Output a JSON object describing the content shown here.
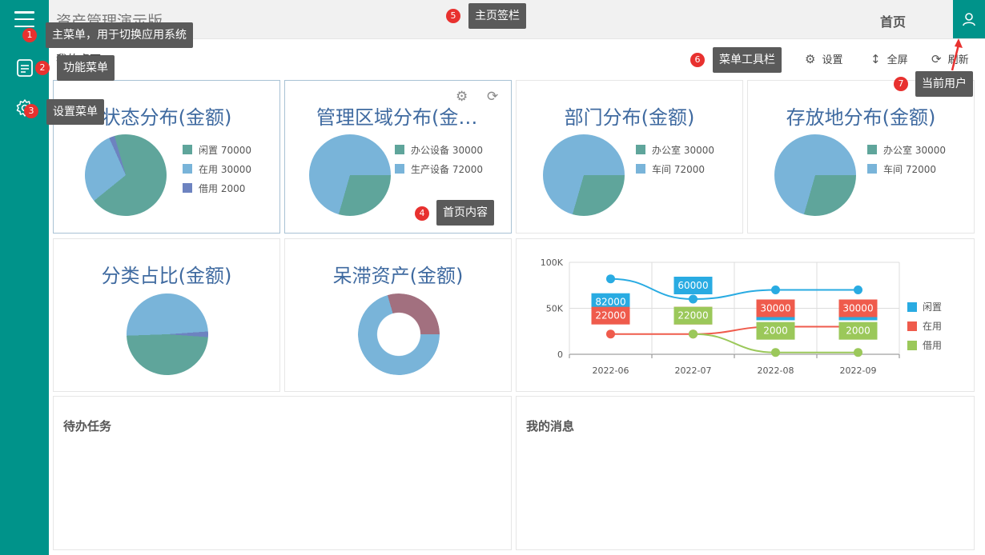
{
  "header": {
    "app_title": "资产管理演示版",
    "home_tab": "首页"
  },
  "desk": {
    "label": "我的桌面"
  },
  "toolbar": {
    "settings": "设置",
    "fullscreen": "全屏",
    "refresh": "刷新"
  },
  "icons": {
    "menu": "hamburger-icon",
    "func": "document-icon",
    "settings": "gear-icon",
    "user": "user-icon"
  },
  "colors": {
    "sidebar": "#00938a",
    "teal": "#5fa59b",
    "blue": "#79b4d9",
    "purple": "#6d83c0",
    "mauve": "#a2707f",
    "cyan": "#29abe2",
    "red": "#ef5b4c",
    "green": "#9bc85a"
  },
  "panels": {
    "p1": {
      "title": "状态分布(金额)",
      "legend": [
        "闲置 70000",
        "在用 30000",
        "借用 2000"
      ]
    },
    "p2": {
      "title": "管理区域分布(金额)",
      "legend": [
        "办公设备 30000",
        "生产设备 72000"
      ]
    },
    "p3": {
      "title": "部门分布(金额)",
      "legend": [
        "办公室 30000",
        "车间 72000"
      ]
    },
    "p4": {
      "title": "存放地分布(金额)",
      "legend": [
        "办公室 30000",
        "车间 72000"
      ]
    },
    "p5": {
      "title": "分类占比(金额)"
    },
    "p6": {
      "title": "呆滞资产(金额)"
    },
    "todo": {
      "title": "待办任务"
    },
    "msg": {
      "title": "我的消息"
    }
  },
  "chart_data": {
    "type": "line",
    "categories": [
      "2022-06",
      "2022-07",
      "2022-08",
      "2022-09"
    ],
    "series": [
      {
        "name": "闲置",
        "values": [
          82000,
          60000,
          70000,
          70000
        ]
      },
      {
        "name": "在用",
        "values": [
          22000,
          22000,
          30000,
          30000
        ]
      },
      {
        "name": "借用",
        "values": [
          null,
          22000,
          2000,
          2000
        ]
      }
    ],
    "yticks": [
      "0",
      "50K",
      "100K"
    ],
    "ylim": [
      0,
      100000
    ],
    "legend_position": "right"
  },
  "annotations": {
    "a1": {
      "num": "1",
      "text": "主菜单，用于切换应用系统"
    },
    "a2": {
      "num": "2",
      "text": "功能菜单"
    },
    "a3": {
      "num": "3",
      "text": "设置菜单"
    },
    "a4": {
      "num": "4",
      "text": "首页内容"
    },
    "a5": {
      "num": "5",
      "text": "主页签栏"
    },
    "a6": {
      "num": "6",
      "text": "菜单工具栏"
    },
    "a7": {
      "num": "7",
      "text": "当前用户"
    }
  }
}
